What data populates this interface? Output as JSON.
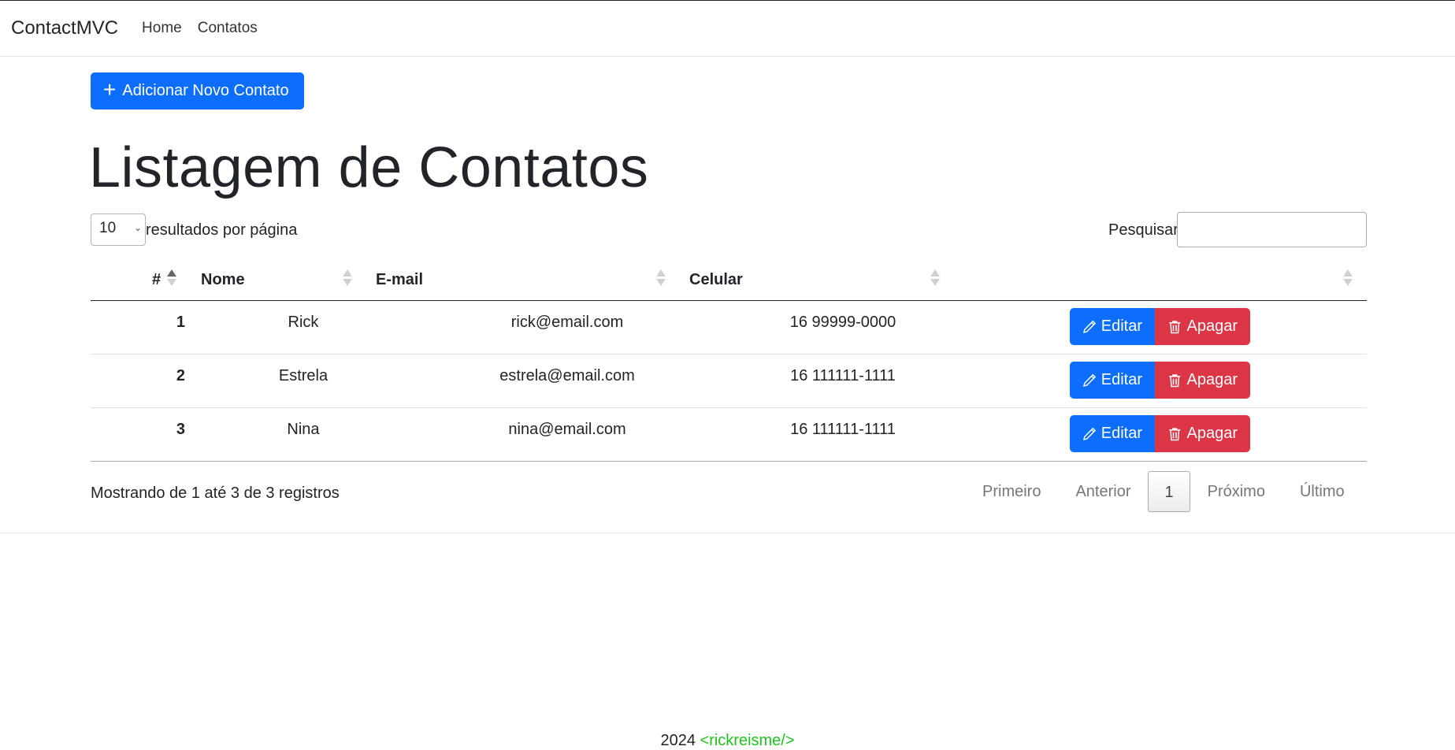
{
  "navbar": {
    "brand": "ContactMVC",
    "links": [
      "Home",
      "Contatos"
    ]
  },
  "add_button": {
    "icon": "plus-icon",
    "label": "Adicionar Novo Contato",
    "color": "#0d6efd"
  },
  "page_title": "Listagem de Contatos",
  "length_menu": {
    "value": "10",
    "label": "resultados por página"
  },
  "search": {
    "label": "Pesquisar",
    "value": ""
  },
  "table": {
    "columns": [
      "#",
      "Nome",
      "E-mail",
      "Celular",
      ""
    ],
    "sorted_column": "#",
    "rows": [
      {
        "id": "1",
        "nome": "Rick",
        "email": "rick@email.com",
        "celular": "16 99999-0000",
        "edit": "Editar",
        "delete": "Apagar"
      },
      {
        "id": "2",
        "nome": "Estrela",
        "email": "estrela@email.com",
        "celular": "16 111111-1111",
        "edit": "Editar",
        "delete": "Apagar"
      },
      {
        "id": "3",
        "nome": "Nina",
        "email": "nina@email.com",
        "celular": "16 111111-1111",
        "edit": "Editar",
        "delete": "Apagar"
      }
    ],
    "edit_color": "#0d6efd",
    "delete_color": "#dc3545"
  },
  "info": "Mostrando de 1 até 3 de 3 registros",
  "pagination": {
    "first": "Primeiro",
    "previous": "Anterior",
    "current": "1",
    "next": "Próximo",
    "last": "Último"
  },
  "footer": {
    "year": "2024",
    "handle": "<rickreisme/>",
    "handle_color": "#1fc21f"
  }
}
